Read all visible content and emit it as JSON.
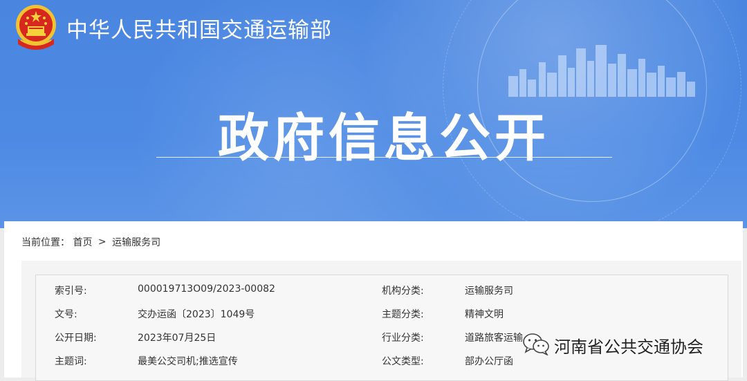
{
  "header": {
    "ministry_name": "中华人民共和国交通运输部",
    "section_title": "政府信息公开",
    "emblem_icon": "national-emblem-icon"
  },
  "breadcrumb": {
    "label": "当前位置：",
    "items": [
      "首页",
      "运输服务司"
    ],
    "separator": ">"
  },
  "info": {
    "rows": [
      {
        "label1": "索引号:",
        "value1": "000019713O09/2023-00082",
        "label2": "机构分类:",
        "value2": "运输服务司"
      },
      {
        "label1": "文号:",
        "value1": "交办运函〔2023〕1049号",
        "label2": "主题分类:",
        "value2": "精神文明"
      },
      {
        "label1": "公开日期:",
        "value1": "2023年07月25日",
        "label2": "行业分类:",
        "value2": "道路旅客运输"
      },
      {
        "label1": "主题词:",
        "value1": "最美公交司机;推选宣传",
        "label2": "公文类型:",
        "value2": "部办公厅函"
      }
    ]
  },
  "watermark": {
    "text": "河南省公共交通协会",
    "icon": "wechat-icon"
  },
  "colors": {
    "banner": "#4a86e0",
    "text": "#333333"
  }
}
